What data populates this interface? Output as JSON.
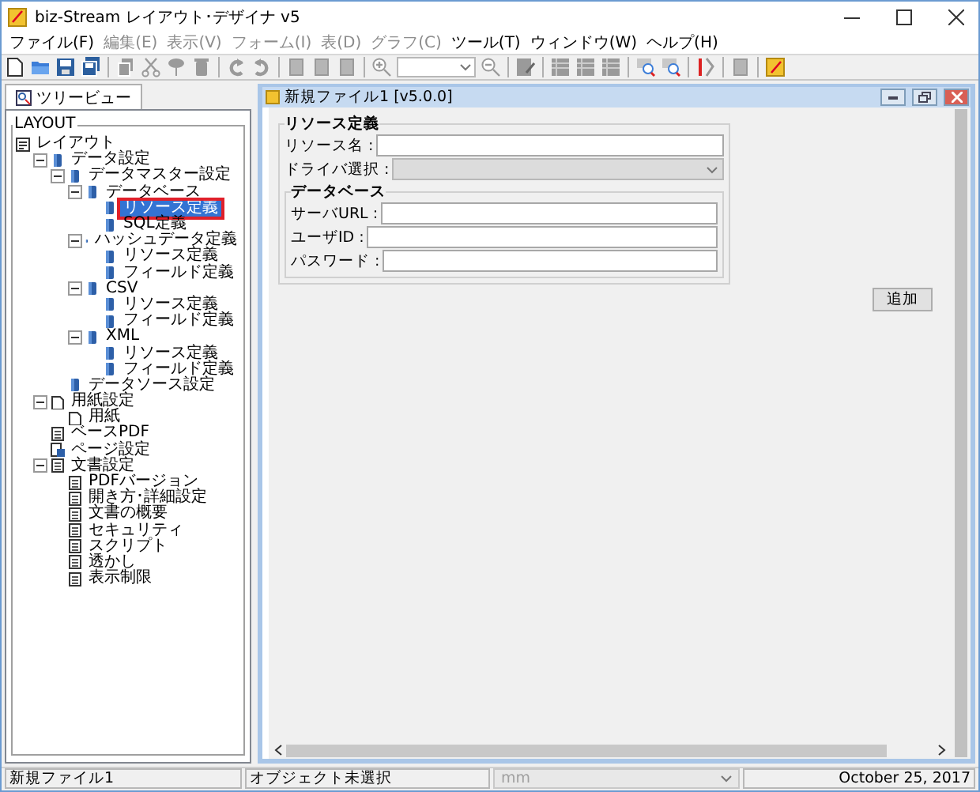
{
  "window": {
    "title": "biz-Stream レイアウト･デザイナ v5"
  },
  "menu": [
    {
      "label": "ファイル(F)",
      "disabled": false
    },
    {
      "label": "編集(E)",
      "disabled": true
    },
    {
      "label": "表示(V)",
      "disabled": true
    },
    {
      "label": "フォーム(I)",
      "disabled": true
    },
    {
      "label": "表(D)",
      "disabled": true
    },
    {
      "label": "グラフ(C)",
      "disabled": true
    },
    {
      "label": "ツール(T)",
      "disabled": false
    },
    {
      "label": "ウィンドウ(W)",
      "disabled": false
    },
    {
      "label": "ヘルプ(H)",
      "disabled": false
    }
  ],
  "toolbar": [
    {
      "kind": "new",
      "disabled": false
    },
    {
      "kind": "open",
      "disabled": false
    },
    {
      "kind": "save",
      "disabled": false
    },
    {
      "kind": "saveall",
      "disabled": false
    },
    {
      "kind": "separator"
    },
    {
      "kind": "copy",
      "disabled": true
    },
    {
      "kind": "cut",
      "disabled": true
    },
    {
      "kind": "paste",
      "disabled": true
    },
    {
      "kind": "delete",
      "disabled": true
    },
    {
      "kind": "separator"
    },
    {
      "kind": "undo",
      "disabled": true
    },
    {
      "kind": "redo",
      "disabled": true
    },
    {
      "kind": "separator"
    },
    {
      "kind": "page",
      "disabled": true
    },
    {
      "kind": "page",
      "disabled": true
    },
    {
      "kind": "page",
      "disabled": true
    },
    {
      "kind": "separator"
    },
    {
      "kind": "zoomin",
      "disabled": true
    },
    {
      "kind": "combo"
    },
    {
      "kind": "zoomout",
      "disabled": true
    },
    {
      "kind": "separator"
    },
    {
      "kind": "edit",
      "disabled": true
    },
    {
      "kind": "separator"
    },
    {
      "kind": "grid",
      "disabled": true
    },
    {
      "kind": "grid",
      "disabled": true
    },
    {
      "kind": "grid",
      "disabled": true
    },
    {
      "kind": "separator"
    },
    {
      "kind": "find",
      "disabled": true
    },
    {
      "kind": "find",
      "disabled": true
    },
    {
      "kind": "separator"
    },
    {
      "kind": "tool",
      "disabled": true
    },
    {
      "kind": "separator"
    },
    {
      "kind": "page",
      "disabled": true
    },
    {
      "kind": "separator"
    },
    {
      "kind": "note",
      "disabled": false
    }
  ],
  "side_tabs": [
    {
      "label": "ツリービュー",
      "selected": true
    }
  ],
  "tree": {
    "title": "LAYOUT",
    "items": [
      {
        "label": "レイアウト",
        "kind": "layout",
        "children": [
          {
            "label": "データ設定",
            "kind": "db",
            "expanded": true,
            "children": [
              {
                "label": "データマスター設定",
                "kind": "db",
                "expanded": true,
                "children": [
                  {
                    "label": "データベース",
                    "kind": "db",
                    "expanded": true,
                    "children": [
                      {
                        "label": "リソース定義",
                        "kind": "db",
                        "selected": true
                      },
                      {
                        "label": "SQL定義",
                        "kind": "db",
                        "selected": false
                      }
                    ]
                  },
                  {
                    "label": "ハッシュデータ定義",
                    "kind": "db",
                    "expanded": true,
                    "children": [
                      {
                        "label": "リソース定義",
                        "kind": "db",
                        "selected": false
                      },
                      {
                        "label": "フィールド定義",
                        "kind": "db",
                        "selected": false
                      }
                    ]
                  },
                  {
                    "label": "CSV",
                    "kind": "db",
                    "expanded": true,
                    "children": [
                      {
                        "label": "リソース定義",
                        "kind": "db",
                        "selected": false
                      },
                      {
                        "label": "フィールド定義",
                        "kind": "db",
                        "selected": false
                      }
                    ]
                  },
                  {
                    "label": "XML",
                    "kind": "db",
                    "expanded": true,
                    "children": [
                      {
                        "label": "リソース定義",
                        "kind": "db",
                        "selected": false
                      },
                      {
                        "label": "フィールド定義",
                        "kind": "db",
                        "selected": false
                      }
                    ]
                  }
                ]
              },
              {
                "label": "データソース設定",
                "kind": "db",
                "selected": false
              }
            ]
          },
          {
            "label": "用紙設定",
            "kind": "paper",
            "expanded": true,
            "children": [
              {
                "label": "用紙",
                "kind": "paper",
                "selected": false
              }
            ]
          },
          {
            "label": "ベースPDF",
            "kind": "doc",
            "selected": false
          },
          {
            "label": "ページ設定",
            "kind": "pagesetup",
            "selected": false
          },
          {
            "label": "文書設定",
            "kind": "doc",
            "expanded": true,
            "children": [
              {
                "label": "PDFバージョン",
                "kind": "doc",
                "selected": false
              },
              {
                "label": "開き方･詳細設定",
                "kind": "doc",
                "selected": false
              },
              {
                "label": "文書の概要",
                "kind": "doc",
                "selected": false
              },
              {
                "label": "セキュリティ",
                "kind": "doc",
                "selected": false
              },
              {
                "label": "スクリプト",
                "kind": "doc",
                "selected": false
              },
              {
                "label": "透かし",
                "kind": "doc",
                "selected": false
              },
              {
                "label": "表示制限",
                "kind": "doc",
                "selected": false
              }
            ]
          }
        ]
      }
    ]
  },
  "document": {
    "title": "新規ファイル1 [v5.0.0]",
    "group": {
      "title": "リソース定義",
      "fields": [
        {
          "label": "リソース名 :",
          "kind": "text",
          "disabled": false
        },
        {
          "label": "ドライバ選択 :",
          "kind": "select",
          "disabled": true
        }
      ],
      "subgroup": {
        "title": "データベース",
        "fields": [
          {
            "label": "サーバURL :",
            "kind": "text",
            "disabled": false
          },
          {
            "label": "ユーザID :",
            "kind": "text",
            "disabled": false
          },
          {
            "label": "パスワード :",
            "kind": "text",
            "disabled": false
          }
        ]
      }
    },
    "button": "追加"
  },
  "status_bar": {
    "file": "新規ファイル1",
    "selection": "オブジェクト未選択",
    "unit": "mm",
    "date": "October 25, 2017"
  }
}
